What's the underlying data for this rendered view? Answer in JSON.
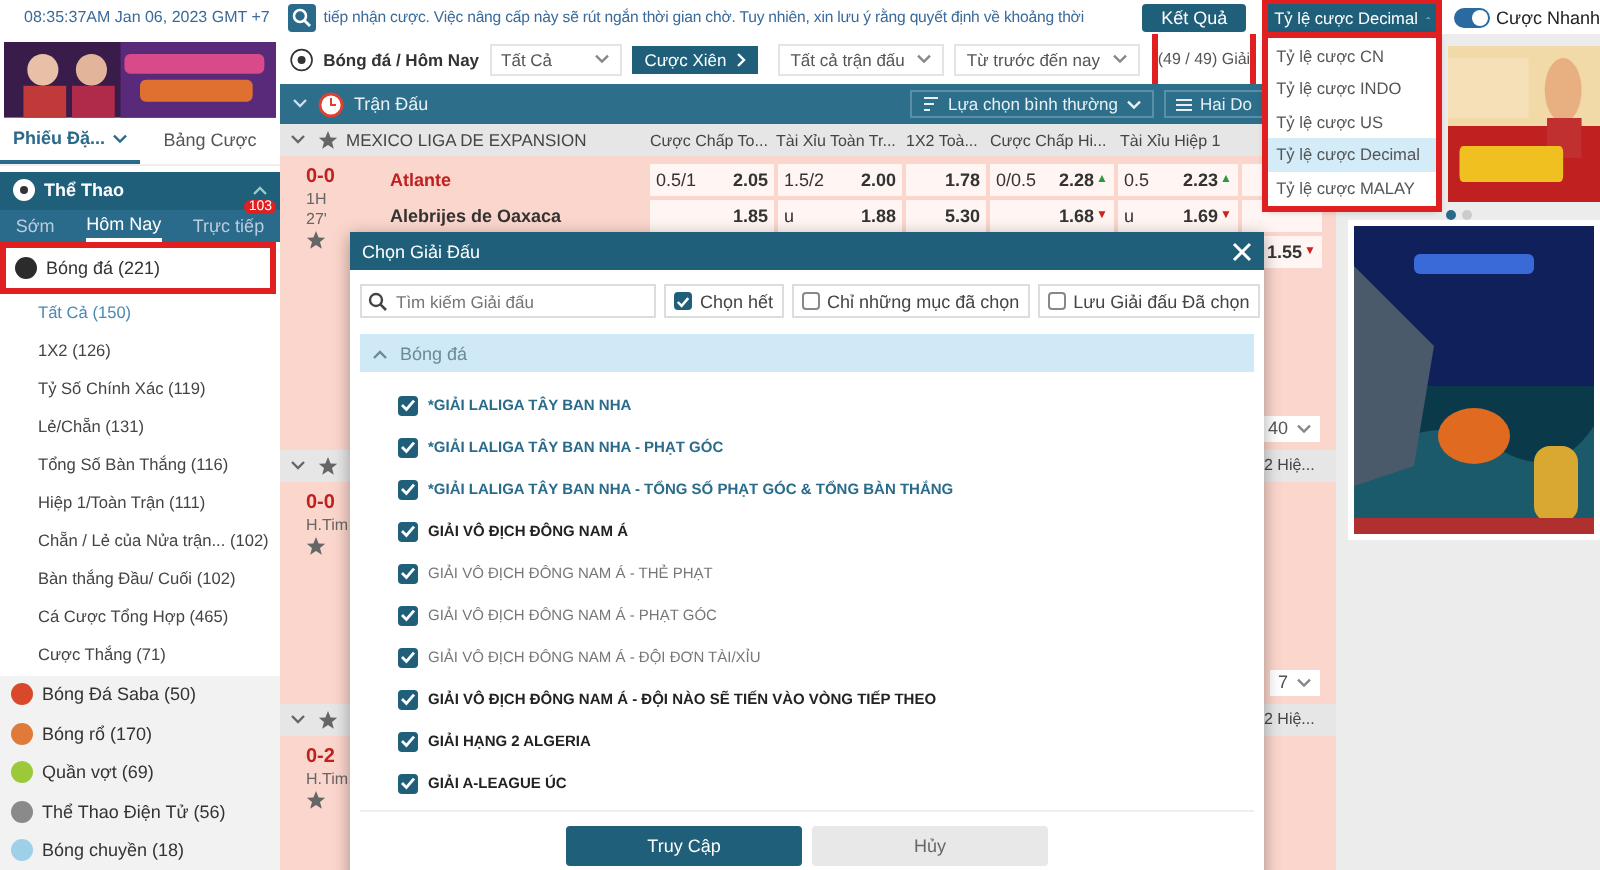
{
  "top_bar": {
    "clock": "08:35:37AM Jan 06, 2023 GMT +7",
    "notice": "tiếp nhận cược. Việc nâng cấp này sẽ rút ngắn thời gian chờ. Tuy nhiên, xin lưu ý rằng quyết định về khoảng thời",
    "results_button": "Kết Quả",
    "odds_format": {
      "label": "Tỷ lệ cược Decimal",
      "expanded": true,
      "highlighted": true,
      "options": [
        {
          "label": "Tỷ lệ cược CN",
          "selected": false
        },
        {
          "label": "Tỷ lệ cược INDO",
          "selected": false
        },
        {
          "label": "Tỷ lệ cược US",
          "selected": false
        },
        {
          "label": "Tỷ lệ cược Decimal",
          "selected": true
        },
        {
          "label": "Tỷ lệ cược MALAY",
          "selected": false
        }
      ]
    },
    "quick_bet": {
      "label": "Cược Nhanh",
      "on": true
    }
  },
  "sidebar": {
    "tabs": [
      {
        "label": "Phiếu Đặ...",
        "selected": true
      },
      {
        "label": "Bảng Cược",
        "selected": false
      }
    ],
    "section": {
      "title": "Thể Thao",
      "expanded": true
    },
    "subtabs": [
      {
        "label": "Sớm",
        "selected": false
      },
      {
        "label": "Hôm Nay",
        "selected": true
      },
      {
        "label": "Trực tiếp",
        "selected": false,
        "badge": "103"
      }
    ],
    "sports": [
      {
        "label": "Bóng đá (221)",
        "color": "#2b2b2b",
        "highlighted": true,
        "expanded": true,
        "children": [
          {
            "label": "Tất Cả (150)",
            "selected": true
          },
          {
            "label": "1X2 (126)",
            "selected": false
          },
          {
            "label": "Tỷ Số Chính Xác (119)",
            "selected": false
          },
          {
            "label": "Lẻ/Chẵn (131)",
            "selected": false
          },
          {
            "label": "Tổng Số Bàn Thắng (116)",
            "selected": false
          },
          {
            "label": "Hiệp 1/Toàn Trận (111)",
            "selected": false
          },
          {
            "label": "Chẵn / Lẻ của Nửa trận... (102)",
            "selected": false
          },
          {
            "label": "Bàn thắng Đầu/ Cuối (102)",
            "selected": false
          },
          {
            "label": "Cá Cược Tổng Hợp (465)",
            "selected": false
          },
          {
            "label": "Cược Thắng (71)",
            "selected": false
          }
        ]
      },
      {
        "label": "Bóng Đá Saba (50)",
        "color": "#d9482b",
        "highlighted": false,
        "expanded": false
      },
      {
        "label": "Bóng rổ (170)",
        "color": "#e07a3a",
        "highlighted": false,
        "expanded": false
      },
      {
        "label": "Quần vợt (69)",
        "color": "#9cc93a",
        "highlighted": false,
        "expanded": false
      },
      {
        "label": "Thể Thao Điện Tử (56)",
        "color": "#8a8a8a",
        "highlighted": false,
        "expanded": false
      },
      {
        "label": "Bóng chuyền (18)",
        "color": "#9fd0ea",
        "highlighted": false,
        "expanded": false
      }
    ]
  },
  "main": {
    "breadcrumb": "Bóng đá / Hôm Nay",
    "filter": "Tất Cả",
    "parlay_button": "Cược Xiên",
    "match_filter": "Tất cả trận đấu",
    "period_filter": "Từ trước đến nay",
    "league_count": {
      "label": "(49 / 49) Giải",
      "highlighted": true
    },
    "section_title": "Trận Đấu",
    "view_select": "Lựa chọn bình thường",
    "layout_button": "Hai Do",
    "columns": [
      "MEXICO LIGA DE EXPANSION",
      "Cược Chấp To...",
      "Tài Xỉu Toàn Tr...",
      "1X2 Toà...",
      "Cược Chấp Hi...",
      "Tài Xỉu Hiệp 1"
    ],
    "match": {
      "score": "0-0",
      "period": "1H",
      "minute": "27'",
      "teams": [
        "Atlante",
        "Alebrijes de Oaxaca"
      ],
      "more_select": "40",
      "rows": [
        [
          {
            "line": "0.5/1",
            "odd": "2.05"
          },
          {
            "line": "1.5/2",
            "odd": "2.00"
          },
          {
            "odd": "1.78"
          },
          {
            "line": "0/0.5",
            "odd": "2.28",
            "arrow": {
              "mark": "▲",
              "color": "#2a9a3a"
            }
          },
          {
            "line": "0.5",
            "odd": "2.23",
            "arrow": {
              "mark": "▲",
              "color": "#2a9a3a"
            }
          },
          {}
        ],
        [
          {
            "odd": "1.85"
          },
          {
            "line": "u",
            "odd": "1.88"
          },
          {
            "odd": "5.30"
          },
          {
            "odd": "1.68",
            "arrow": {
              "mark": "▼",
              "color": "#d02020"
            }
          },
          {
            "line": "u",
            "odd": "1.69",
            "arrow": {
              "mark": "▼",
              "color": "#d02020"
            }
          },
          {}
        ],
        [
          null,
          null,
          null,
          null,
          null,
          {
            "odd": "1.55",
            "arrow": {
              "mark": "▼",
              "color": "#d02020"
            }
          }
        ]
      ]
    },
    "more_leagues": [
      {
        "column_label": "2 Hiệ...",
        "score": "0-0",
        "time": "H.Tim",
        "more_select": "7"
      },
      {
        "column_label": "2 Hiệ...",
        "score": "0-2",
        "time": "H.Tim"
      }
    ]
  },
  "modal": {
    "title": "Chọn Giải Đấu",
    "search": {
      "placeholder": "Tìm kiếm Giải đấu"
    },
    "options": [
      {
        "label": "Chọn hết",
        "checked": true
      },
      {
        "label": "Chỉ những mục đã chọn",
        "checked": false
      },
      {
        "label": "Lưu Giải đấu Đã chọn",
        "checked": false
      }
    ],
    "group": {
      "label": "Bóng đá",
      "expanded": true
    },
    "leagues": [
      {
        "label": "*GIẢI LALIGA TÂY BAN NHA",
        "checked": true,
        "kind": "featured"
      },
      {
        "label": "*GIẢI LALIGA TÂY BAN NHA - PHẠT GÓC",
        "checked": true,
        "kind": "featured"
      },
      {
        "label": "*GIẢI LALIGA TÂY BAN NHA - TỔNG SỐ PHẠT GÓC & TỔNG BÀN THẮNG",
        "checked": true,
        "kind": "featured"
      },
      {
        "label": "GIẢI VÔ ĐỊCH ĐÔNG NAM Á",
        "checked": true,
        "kind": "bold"
      },
      {
        "label": "GIẢI VÔ ĐỊCH ĐÔNG NAM Á - THẺ PHẠT",
        "checked": true,
        "kind": "plain"
      },
      {
        "label": "GIẢI VÔ ĐỊCH ĐÔNG NAM Á - PHẠT GÓC",
        "checked": true,
        "kind": "plain"
      },
      {
        "label": "GIẢI VÔ ĐỊCH ĐÔNG NAM Á - ĐỘI ĐƠN TÀI/XỈU",
        "checked": true,
        "kind": "plain"
      },
      {
        "label": "GIẢI VÔ ĐỊCH ĐÔNG NAM Á - ĐỘI NÀO SẼ TIẾN VÀO VÒNG TIẾP THEO",
        "checked": true,
        "kind": "bold"
      },
      {
        "label": "GIẢI HẠNG 2 ALGERIA",
        "checked": true,
        "kind": "bold"
      },
      {
        "label": "GIẢI A-LEAGUE ÚC",
        "checked": true,
        "kind": "bold"
      }
    ],
    "buttons": [
      {
        "label": "Truy Cập",
        "kind": "primary"
      },
      {
        "label": "Hủy",
        "kind": "secondary"
      }
    ]
  }
}
